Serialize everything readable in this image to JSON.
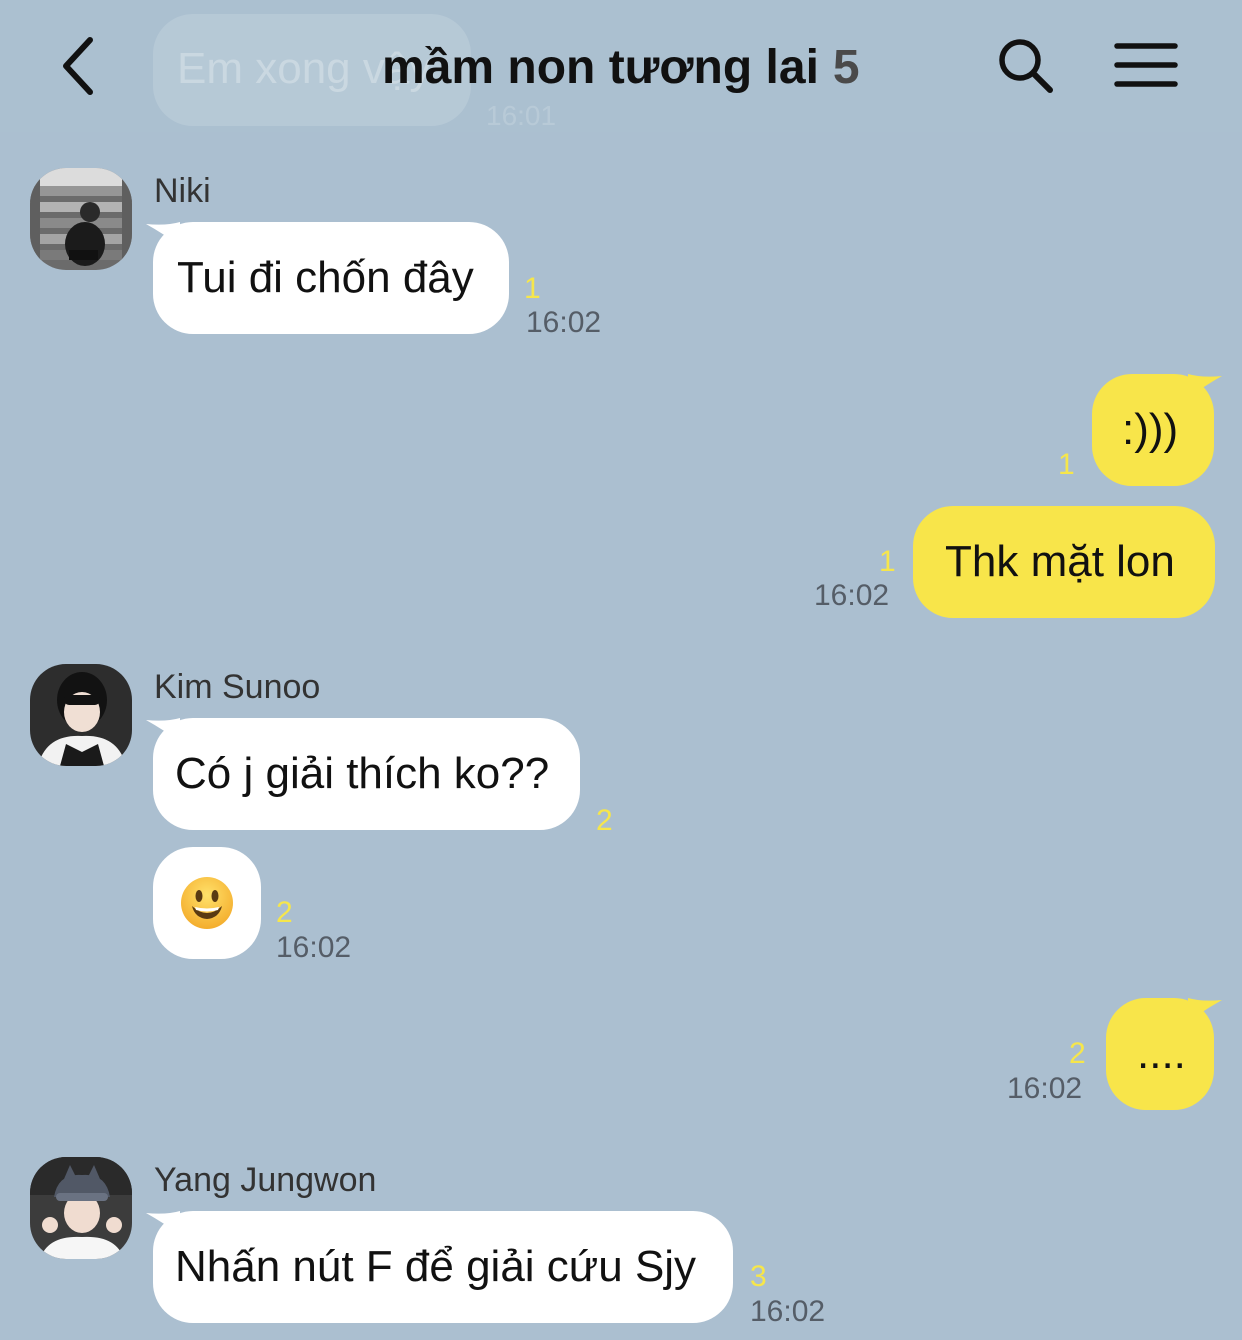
{
  "header": {
    "title": "mầm non tương lai",
    "member_count": "5",
    "ghost_preview_text": "Em xong vậy",
    "ghost_preview_time": "16:01",
    "back_icon": "chevron-left-icon",
    "search_icon": "search-icon",
    "menu_icon": "menu-icon"
  },
  "colors": {
    "background": "#abbfd0",
    "incoming_bubble": "#ffffff",
    "outgoing_bubble": "#f8e54a",
    "read_count": "#f6e64b",
    "time": "#555d67"
  },
  "messages": [
    {
      "sender": "Niki",
      "text": "Tui đi chốn đây",
      "read_count": "1",
      "time": "16:02"
    },
    {
      "text": ":)))",
      "read_count": "1"
    },
    {
      "text": "Thk mặt lon",
      "read_count": "1",
      "time": "16:02"
    },
    {
      "sender": "Kim Sunoo",
      "text": "Có j giải thích ko??",
      "read_count": "2"
    },
    {
      "emoji": "grinning-face",
      "read_count": "2",
      "time": "16:02"
    },
    {
      "text": "....",
      "read_count": "2",
      "time": "16:02"
    },
    {
      "sender": "Yang Jungwon",
      "text": "Nhấn nút F để giải cứu Sjy",
      "read_count": "3",
      "time": "16:02"
    }
  ]
}
